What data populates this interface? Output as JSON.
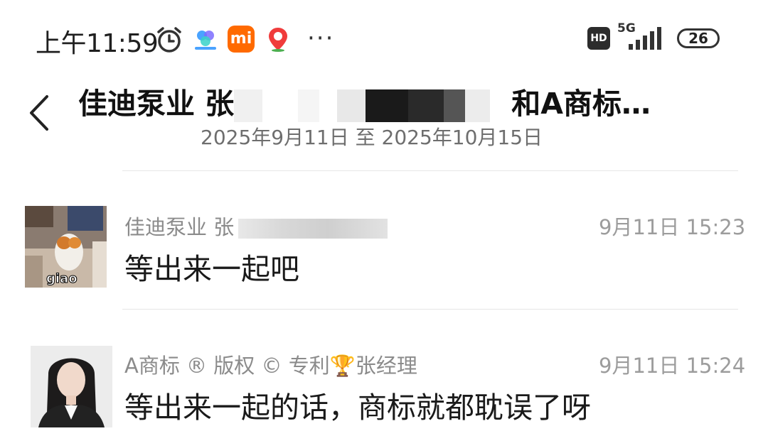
{
  "status_bar": {
    "time": "上午11:59",
    "network": "5G",
    "hd": "HD",
    "battery": "26",
    "more": "···",
    "mi_label": "mi"
  },
  "header": {
    "title_start": "佳迪泵业 张",
    "title_end": "和A商标…",
    "date_range": "2025年9月11日 至 2025年10月15日"
  },
  "messages": [
    {
      "sender": "佳迪泵业 张",
      "time": "9月11日 15:23",
      "text": "等出来一起吧",
      "avatar_caption": "giao"
    },
    {
      "sender": "A商标 ® 版权 © 专利🏆张经理",
      "time": "9月11日 15:24",
      "text": "等出来一起的话，商标就都耽误了呀"
    }
  ],
  "colors": {
    "background": "#ffffff",
    "secondary_text": "#8b8b8b",
    "divider": "#e6e6e6",
    "mi_brand": "#ff6a00"
  }
}
